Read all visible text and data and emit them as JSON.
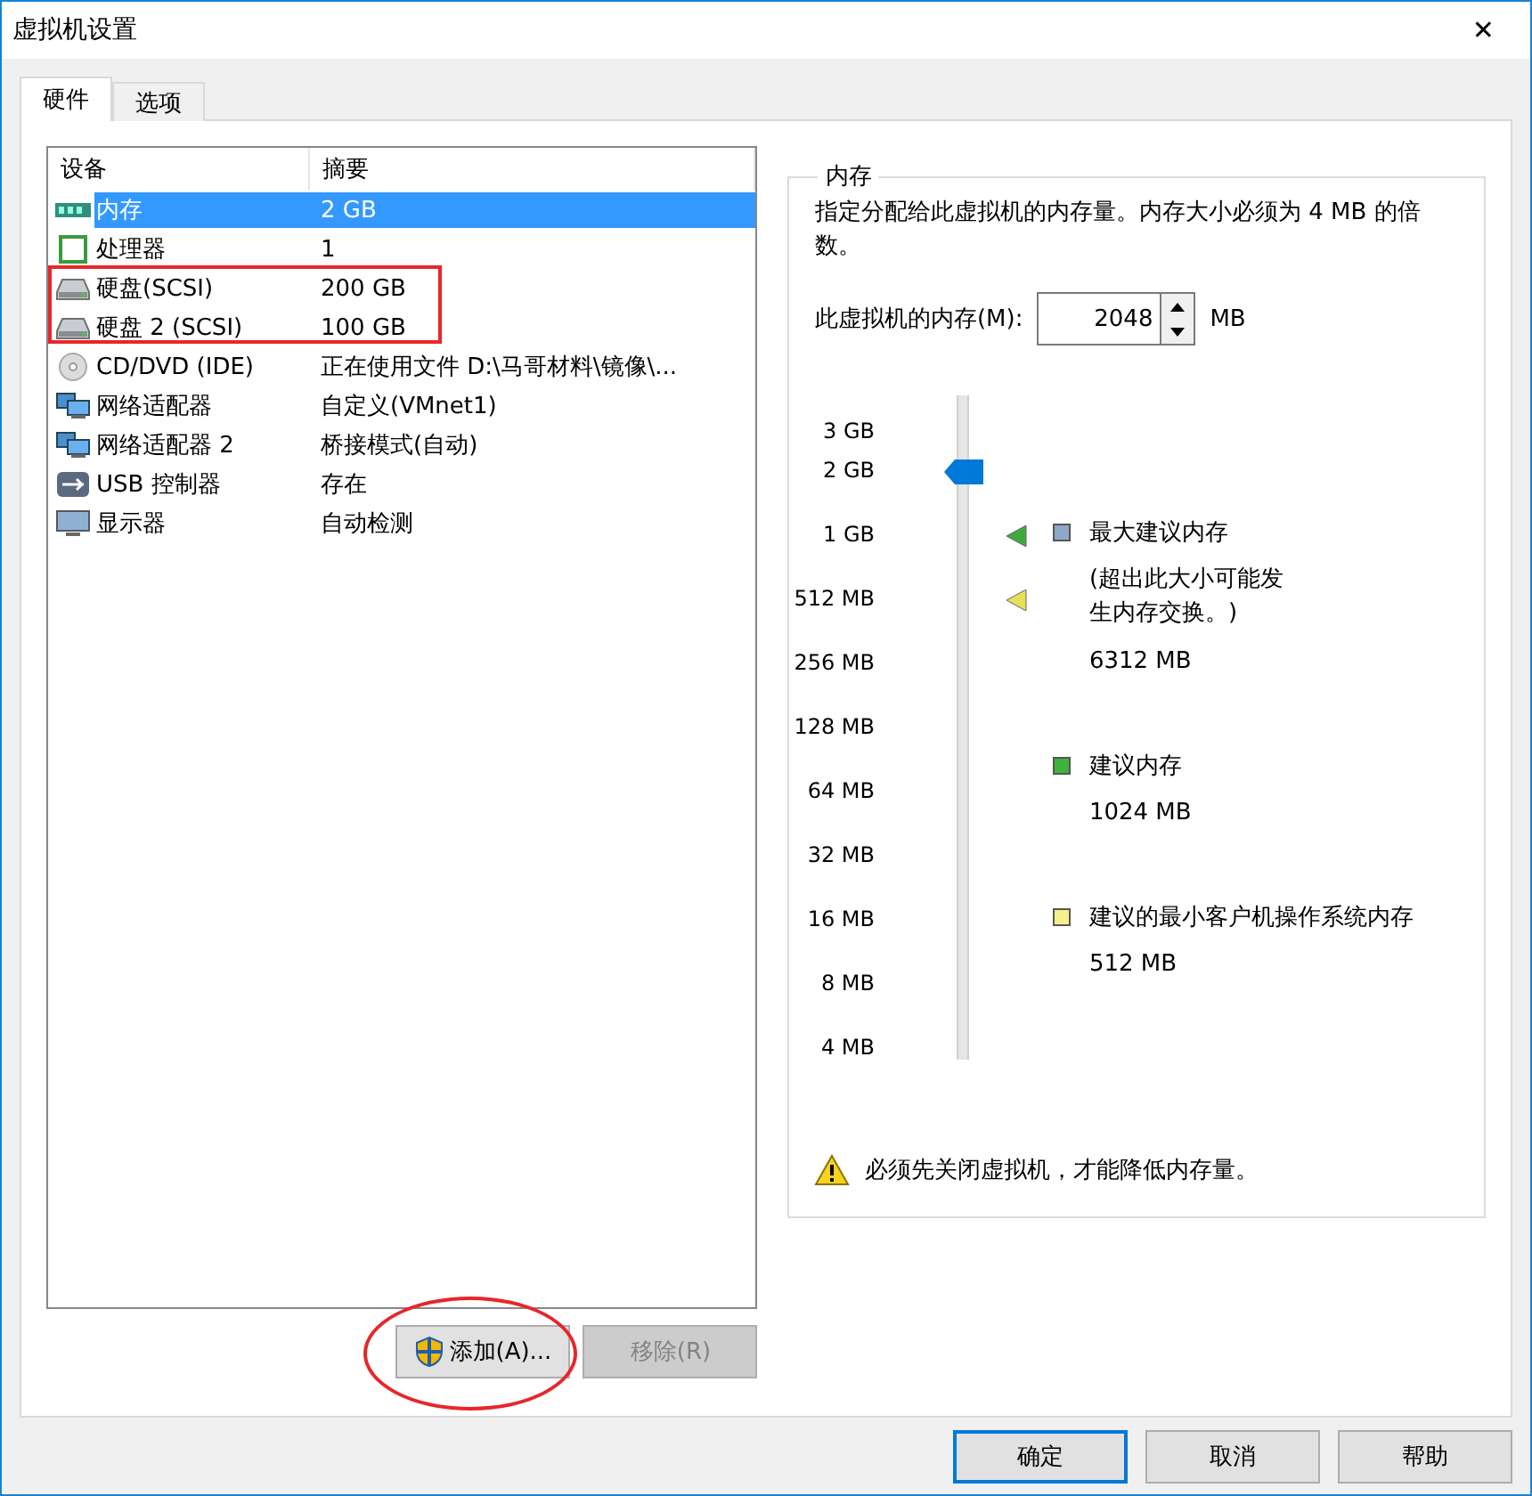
{
  "window": {
    "title": "虚拟机设置",
    "close": "✕"
  },
  "tabs": [
    {
      "label": "硬件",
      "selected": true
    },
    {
      "label": "选项",
      "selected": false
    }
  ],
  "devices": {
    "columns": [
      "设备",
      "摘要"
    ],
    "rows": [
      {
        "kind": "memory",
        "name": "内存",
        "summary": "2 GB",
        "selected": true
      },
      {
        "kind": "cpu",
        "name": "处理器",
        "summary": "1",
        "selected": false
      },
      {
        "kind": "disk",
        "name": "硬盘(SCSI)",
        "summary": "200 GB",
        "selected": false
      },
      {
        "kind": "disk",
        "name": "硬盘 2 (SCSI)",
        "summary": "100 GB",
        "selected": false
      },
      {
        "kind": "cd",
        "name": "CD/DVD (IDE)",
        "summary": "正在使用文件 D:\\马哥材料\\镜像\\...",
        "selected": false
      },
      {
        "kind": "network",
        "name": "网络适配器",
        "summary": "自定义(VMnet1)",
        "selected": false
      },
      {
        "kind": "network",
        "name": "网络适配器 2",
        "summary": "桥接模式(自动)",
        "selected": false
      },
      {
        "kind": "usb",
        "name": "USB 控制器",
        "summary": "存在",
        "selected": false
      },
      {
        "kind": "display",
        "name": "显示器",
        "summary": "自动检测",
        "selected": false
      }
    ]
  },
  "device_buttons": [
    {
      "label": "添加(A)...",
      "disabled": false,
      "shield": true
    },
    {
      "label": "移除(R)",
      "disabled": true,
      "shield": false
    }
  ],
  "memory": {
    "title": "内存",
    "description": "指定分配给此虚拟机的内存量。内存大小必须为 4 MB 的倍数。",
    "field_label": "此虚拟机的内存(M):",
    "value": "2048",
    "unit": "MB",
    "scale": [
      "3 GB",
      "2 GB",
      "1 GB",
      "512 MB",
      "256 MB",
      "128 MB",
      "64 MB",
      "32 MB",
      "16 MB",
      "8 MB",
      "4 MB"
    ],
    "level": 0.885,
    "markers": [
      {
        "color": "#3fa83f"
      },
      {
        "color": "#e6e05a"
      }
    ],
    "legend": [
      {
        "color": "#8ea8cc",
        "label": "最大建议内存",
        "note": "(超出此大小可能发生内存交换。)",
        "value": "6312 MB"
      },
      {
        "color": "#3cb43c",
        "label": "建议内存",
        "value": "1024 MB"
      },
      {
        "color": "#f4f08c",
        "label": "建议的最小客户机操作系统内存",
        "value": "512 MB"
      }
    ],
    "warning": "必须先关闭虚拟机，才能降低内存量。"
  },
  "dialog_buttons": [
    {
      "label": "确定",
      "default": true
    },
    {
      "label": "取消",
      "default": false
    },
    {
      "label": "帮助",
      "default": false
    }
  ]
}
